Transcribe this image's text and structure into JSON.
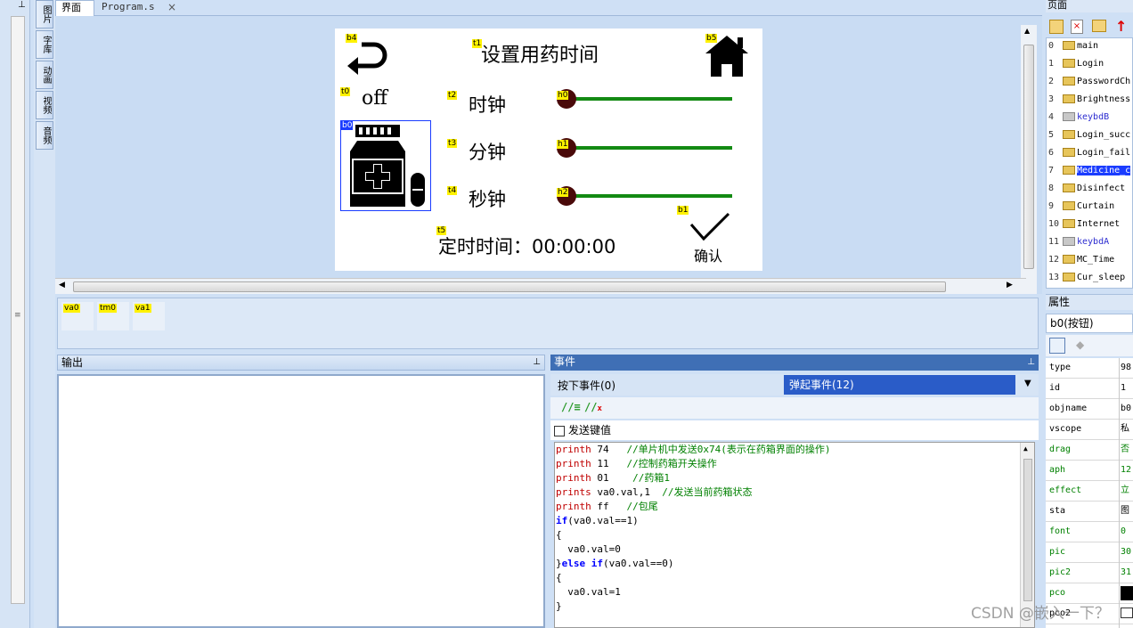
{
  "vtabs": [
    "图片",
    "字库",
    "动画",
    "视频",
    "音频"
  ],
  "doc_tabs": {
    "ui": "界面",
    "program": "Program.s",
    "close": "×"
  },
  "hmi": {
    "title": "设置用药时间",
    "off_text": "off",
    "hour_label": "时钟",
    "minute_label": "分钟",
    "second_label": "秒钟",
    "timer_text": "定时时间：00:00:00",
    "confirm_label": "确认",
    "tags": {
      "b4": "b4",
      "t1": "t1",
      "b5": "b5",
      "t0": "t0",
      "t2": "t2",
      "h0": "h0",
      "b0": "b0",
      "t3": "t3",
      "h1": "h1",
      "t4": "t4",
      "h2": "h2",
      "b1": "b1",
      "t5": "t5"
    },
    "slider_levels": {
      "h0": 0,
      "h1": 0,
      "h2": 0
    }
  },
  "tray": [
    "va0",
    "tm0",
    "va1"
  ],
  "output": {
    "title": "输出"
  },
  "events": {
    "title": "事件",
    "press_tab": "按下事件(0)",
    "release_tab": "弹起事件(12)",
    "send_key_label": "发送键值",
    "code": [
      [
        {
          "t": "printh",
          "c": "kw"
        },
        {
          "t": " 74   "
        },
        {
          "t": "//单片机中发送0x74(表示在药箱界面的操作)",
          "c": "cm"
        }
      ],
      [
        {
          "t": "printh",
          "c": "kw"
        },
        {
          "t": " 11   "
        },
        {
          "t": "//控制药箱开关操作",
          "c": "cm"
        }
      ],
      [
        {
          "t": "printh",
          "c": "kw"
        },
        {
          "t": " 01    "
        },
        {
          "t": "//药箱1",
          "c": "cm"
        }
      ],
      [
        {
          "t": "prints",
          "c": "kw"
        },
        {
          "t": " va0.val,1  "
        },
        {
          "t": "//发送当前药箱状态",
          "c": "cm"
        }
      ],
      [
        {
          "t": "printh",
          "c": "kw"
        },
        {
          "t": " ff   "
        },
        {
          "t": "//包尾",
          "c": "cm"
        }
      ],
      [
        {
          "t": "if",
          "c": "kw2"
        },
        {
          "t": "(va0.val==1)"
        }
      ],
      [
        {
          "t": "{"
        }
      ],
      [
        {
          "t": "  va0.val=0"
        }
      ],
      [
        {
          "t": "}"
        },
        {
          "t": "else",
          "c": "kw2"
        },
        {
          "t": " "
        },
        {
          "t": "if",
          "c": "kw2"
        },
        {
          "t": "(va0.val==0)"
        }
      ],
      [
        {
          "t": "{"
        }
      ],
      [
        {
          "t": "  va0.val=1"
        }
      ],
      [
        {
          "t": "}"
        }
      ]
    ]
  },
  "pages": {
    "title": "页面",
    "items": [
      {
        "num": "0",
        "name": "main",
        "state": "normal"
      },
      {
        "num": "1",
        "name": "Login",
        "state": "normal"
      },
      {
        "num": "2",
        "name": "PasswordCh",
        "state": "normal"
      },
      {
        "num": "3",
        "name": "Brightness",
        "state": "normal"
      },
      {
        "num": "4",
        "name": "keybdB",
        "state": "locked"
      },
      {
        "num": "5",
        "name": "Login_succ",
        "state": "normal"
      },
      {
        "num": "6",
        "name": "Login_fail",
        "state": "normal"
      },
      {
        "num": "7",
        "name": "Medicine_c",
        "state": "selected"
      },
      {
        "num": "8",
        "name": "Disinfect",
        "state": "normal"
      },
      {
        "num": "9",
        "name": "Curtain",
        "state": "normal"
      },
      {
        "num": "10",
        "name": "Internet",
        "state": "normal"
      },
      {
        "num": "11",
        "name": "keybdA",
        "state": "locked"
      },
      {
        "num": "12",
        "name": "MC_Time",
        "state": "normal"
      },
      {
        "num": "13",
        "name": "Cur_sleep",
        "state": "normal"
      }
    ]
  },
  "props": {
    "title": "属性",
    "object": "b0(按钮)",
    "rows": [
      {
        "k": "type",
        "v": "98",
        "g": false
      },
      {
        "k": "id",
        "v": "1",
        "g": false
      },
      {
        "k": "objname",
        "v": "b0",
        "g": false
      },
      {
        "k": "vscope",
        "v": "私",
        "g": false
      },
      {
        "k": "drag",
        "v": "否",
        "g": true
      },
      {
        "k": "aph",
        "v": "12",
        "g": true
      },
      {
        "k": "effect",
        "v": "立",
        "g": true
      },
      {
        "k": "sta",
        "v": "图",
        "g": false
      },
      {
        "k": "font",
        "v": "0",
        "g": true
      },
      {
        "k": "pic",
        "v": "30",
        "g": true
      },
      {
        "k": "pic2",
        "v": "31",
        "g": true
      },
      {
        "k": "pco",
        "v": "",
        "g": true
      },
      {
        "k": "pco2",
        "v": "",
        "g": false
      }
    ]
  },
  "watermark": "CSDN @嵌入一下？",
  "colors": {
    "accent": "#2a5cc8",
    "slider": "#138a13",
    "knob": "#4a0a0a",
    "tag": "#fff200"
  }
}
